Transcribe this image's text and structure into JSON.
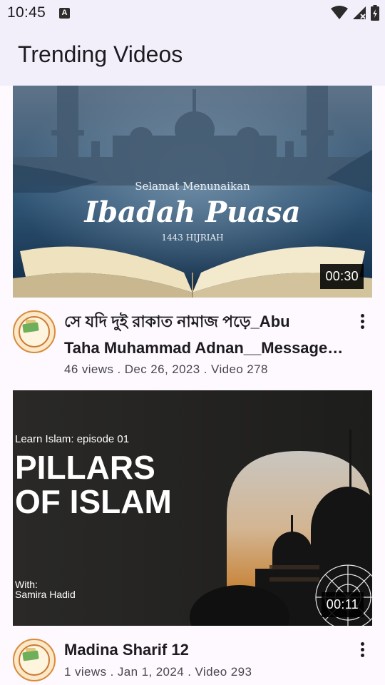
{
  "status_bar": {
    "time": "10:45",
    "notification_letter": "A"
  },
  "app_bar": {
    "title": "Trending Videos"
  },
  "videos": [
    {
      "thumbnail_text": {
        "line1": "Selamat Menunaikan",
        "line2": "Ibadah Puasa",
        "line3": "1443 HIJRIAH"
      },
      "duration": "00:30",
      "title_line1": "সে যদি দুই রাকাত নামাজ পড়ে_Abu",
      "title_line2": "Taha Muhammad Adnan__Message…",
      "meta": "46 views . Dec 26, 2023   .  Video 278"
    },
    {
      "thumbnail_text": {
        "line1": "Learn Islam: episode 01",
        "line2": "PILLARS",
        "line3": "OF ISLAM",
        "line4": "With:",
        "line5": "Samira Hadid"
      },
      "duration": "00:11",
      "title_line1": "Madina Sharif 12",
      "meta": "1 views . Jan 1, 2024   .  Video 293"
    }
  ]
}
